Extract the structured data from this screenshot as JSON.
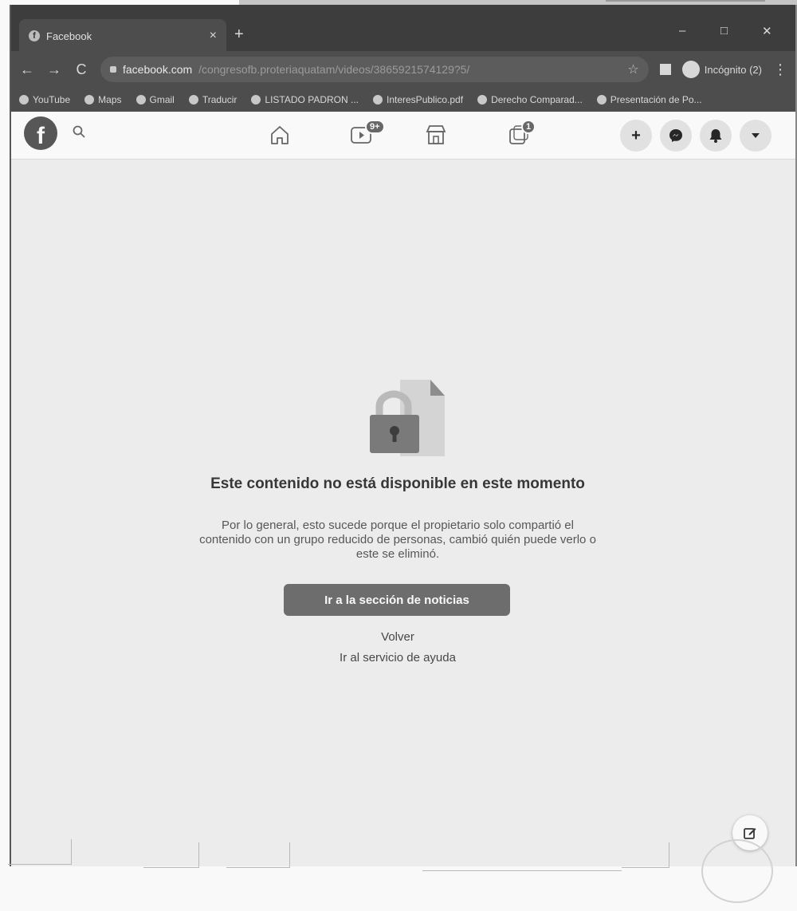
{
  "browser": {
    "tab_title": "Facebook",
    "tab_close": "×",
    "new_tab": "+",
    "window_controls": [
      "–",
      "□",
      "✕"
    ],
    "nav": {
      "back": "←",
      "forward": "→",
      "reload": "C"
    },
    "url": {
      "host": "facebook.com",
      "path": "/congresofb.proteriaquatam/videos/3865921574129?5/"
    },
    "star": "☆",
    "profile_label": "Incógnito (2)",
    "menu": "⋮",
    "bookmarks": [
      {
        "label": "YouTube",
        "icon": "youtube-icon"
      },
      {
        "label": "Maps",
        "icon": "maps-icon"
      },
      {
        "label": "Gmail",
        "icon": "gmail-icon"
      },
      {
        "label": "Traducir",
        "icon": "translate-icon"
      },
      {
        "label": "LISTADO PADRON ...",
        "icon": "globe-icon"
      },
      {
        "label": "InteresPublico.pdf",
        "icon": "globe-icon"
      },
      {
        "label": "Derecho Comparad...",
        "icon": "globe-icon"
      },
      {
        "label": "Presentación de Po...",
        "icon": "globe-icon"
      }
    ]
  },
  "facebook_header": {
    "logo": "f",
    "watch_badge": "9+",
    "gaming_badge": "1",
    "actions": {
      "create": "+"
    }
  },
  "unavailable": {
    "title": "Este contenido no está disponible en este momento",
    "description": "Por lo general, esto sucede porque el propietario solo compartió el contenido con un grupo reducido de personas, cambió quién puede verlo o este se eliminó.",
    "primary_button": "Ir a la sección de noticias",
    "back_link": "Volver",
    "help_link": "Ir al servicio de ayuda"
  },
  "colors": {
    "button": "#6c6c6c",
    "page_bg": "#f0f2f5",
    "chrome_dark": "#3a3a3a"
  }
}
